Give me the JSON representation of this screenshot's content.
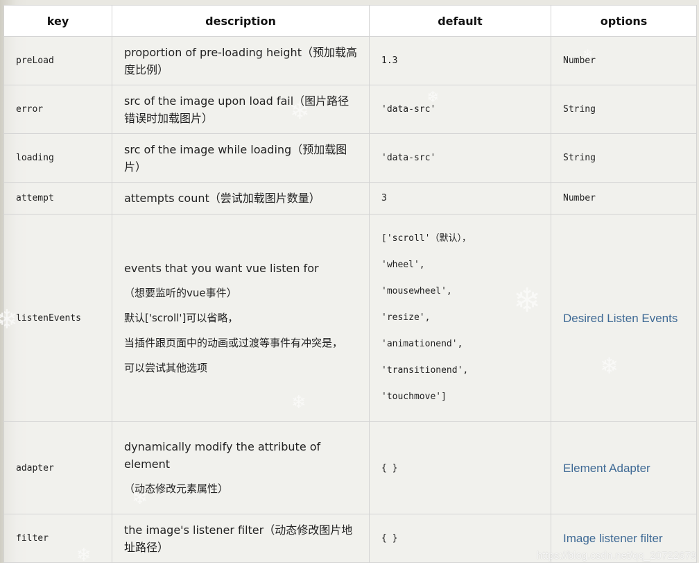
{
  "table": {
    "headers": [
      "key",
      "description",
      "default",
      "options"
    ],
    "rows": {
      "preload": {
        "key": "preLoad",
        "desc": "proportion of pre-loading height（预加载高度比例）",
        "default": "1.3",
        "option": "Number"
      },
      "error": {
        "key": "error",
        "desc": "src of the image upon load fail（图片路径错误时加载图片）",
        "default": "'data-src'",
        "option": "String"
      },
      "loading": {
        "key": "loading",
        "desc": "src of the image while loading（预加载图片）",
        "default": "'data-src'",
        "option": "String"
      },
      "attempt": {
        "key": "attempt",
        "desc": "attempts count（尝试加载图片数量）",
        "default": "3",
        "option": "Number"
      },
      "listenEvents": {
        "key": "listenEvents",
        "desc_lines": [
          "events that you want vue listen for",
          "（想要监听的vue事件）",
          "默认['scroll']可以省略，",
          "当插件跟页面中的动画或过渡等事件有冲突是，",
          "可以尝试其他选项"
        ],
        "default_lines": [
          "['scroll'（默认），",
          "'wheel',",
          "'mousewheel',",
          "'resize',",
          "'animationend',",
          "'transitionend',",
          "'touchmove']"
        ],
        "option": "Desired Listen Events"
      },
      "adapter": {
        "key": "adapter",
        "desc_lines": [
          "dynamically modify the attribute of element",
          "（动态修改元素属性）"
        ],
        "default": "{ }",
        "option": "Element Adapter"
      },
      "filter": {
        "key": "filter",
        "desc": "the image's listener filter（动态修改图片地址路径）",
        "default": "{ }",
        "option": "Image listener filter"
      }
    }
  },
  "watermark": "https://blog.csdn.net/qq_20722679",
  "colors": {
    "link": "#3f6a95",
    "border": "#d4d4d4",
    "background": "#e9e8e2"
  }
}
